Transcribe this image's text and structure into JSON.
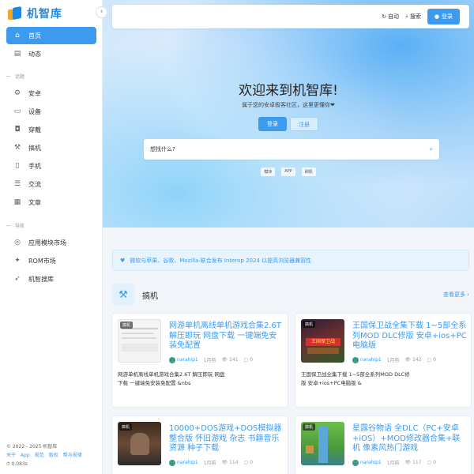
{
  "app": {
    "name": "机智库"
  },
  "sidebar": {
    "items": [
      {
        "label": "首页",
        "icon": "home-icon",
        "glyph": "⌂",
        "active": true
      },
      {
        "label": "动态",
        "icon": "list-icon",
        "glyph": "▤"
      }
    ],
    "section1": "话题",
    "topics": [
      {
        "label": "安卓",
        "icon": "android-icon",
        "glyph": "⚙"
      },
      {
        "label": "设备",
        "icon": "monitor-icon",
        "glyph": "▭"
      },
      {
        "label": "穿戴",
        "icon": "watch-icon",
        "glyph": "◘"
      },
      {
        "label": "搞机",
        "icon": "wrench-icon",
        "glyph": "⚒"
      },
      {
        "label": "手机",
        "icon": "phone-icon",
        "glyph": "▯"
      },
      {
        "label": "交流",
        "icon": "chat-icon",
        "glyph": "☰"
      },
      {
        "label": "文章",
        "icon": "document-icon",
        "glyph": "▦"
      }
    ],
    "section2": "导航",
    "nav": [
      {
        "label": "应用模块市场",
        "icon": "compass-icon",
        "glyph": "◎"
      },
      {
        "label": "ROM市场",
        "icon": "chip-icon",
        "glyph": "✦"
      },
      {
        "label": "机智搜库",
        "icon": "send-icon",
        "glyph": "➶"
      }
    ],
    "footer": {
      "copyright": "© 2022 - 2025 机智库",
      "links": [
        "关于",
        "App",
        "规范",
        "版权",
        "帮与规律"
      ],
      "timing": "⏱ 0.083s"
    }
  },
  "topbar": {
    "auto": "自动",
    "search": "搜索",
    "login": "登录"
  },
  "hero": {
    "title": "欢迎来到机智库!",
    "subtitle": "属于您的安卓极客社区，这里更懂你❤",
    "login": "登录",
    "register": "注册",
    "search_placeholder": "想找什么?",
    "tags": [
      "模块",
      "APP",
      "刷机"
    ]
  },
  "notice": "微软与苹果、谷歌、Mozilla 联合发布 Interop 2024 以提高浏览器兼容性",
  "section": {
    "title": "搞机",
    "more": "查看更多"
  },
  "cards": [
    {
      "badge": "搞机",
      "title": "网游单机离线单机游戏合集2.6T 解压即玩 网盘下载 一键端免安装免配置",
      "author": "narahip1",
      "time": "1月前",
      "views": "141",
      "comments": "0",
      "excerpt": "网游单机离线单机游戏合集2.6T 解压即玩 网盘下载 一键端免安装免配置 &nbs"
    },
    {
      "badge": "搞机",
      "title": "王国保卫战全集下载 1~5部全系列MOD DLC修版 安卓+ios+PC电脑版",
      "author": "narahip1",
      "time": "1月前",
      "views": "142",
      "comments": "0",
      "excerpt": "王国保卫战全集下载 1~5部全系列MOD DLC修版 安卓+ios+PC电脑版 &"
    },
    {
      "badge": "搞机",
      "title": "10000+DOS游戏+DOS模拟器 整合版 怀旧游戏 杂志 书籍音乐资源 种子下载",
      "author": "narahip1",
      "time": "1月前",
      "views": "114",
      "comments": "0",
      "excerpt": ""
    },
    {
      "badge": "搞机",
      "title": "星露谷物语 全DLC（PC+安卓+iOS）+MOD修改器合集+联机 像素风热门游戏",
      "author": "narahip1",
      "time": "1月前",
      "views": "117",
      "comments": "0",
      "excerpt": ""
    }
  ],
  "colors": {
    "accent": "#3d9bef",
    "accent_light": "#e3f0fd"
  }
}
